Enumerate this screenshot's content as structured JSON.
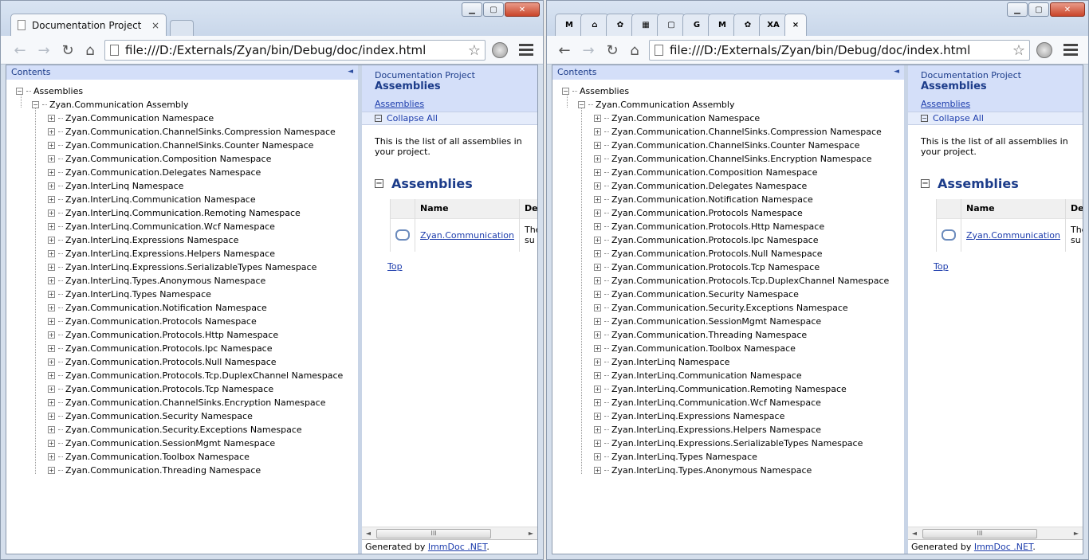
{
  "window1": {
    "tab_title": "Documentation Project",
    "tab_close": "×",
    "url": "file:///D:/Externals/Zyan/bin/Debug/doc/index.html",
    "tree_items": [
      "Zyan.Communication Namespace",
      "Zyan.Communication.ChannelSinks.Compression Namespace",
      "Zyan.Communication.ChannelSinks.Counter Namespace",
      "Zyan.Communication.Composition Namespace",
      "Zyan.Communication.Delegates Namespace",
      "Zyan.InterLinq Namespace",
      "Zyan.InterLinq.Communication Namespace",
      "Zyan.InterLinq.Communication.Remoting Namespace",
      "Zyan.InterLinq.Communication.Wcf Namespace",
      "Zyan.InterLinq.Expressions Namespace",
      "Zyan.InterLinq.Expressions.Helpers Namespace",
      "Zyan.InterLinq.Expressions.SerializableTypes Namespace",
      "Zyan.InterLinq.Types.Anonymous Namespace",
      "Zyan.InterLinq.Types Namespace",
      "Zyan.Communication.Notification Namespace",
      "Zyan.Communication.Protocols Namespace",
      "Zyan.Communication.Protocols.Http Namespace",
      "Zyan.Communication.Protocols.Ipc Namespace",
      "Zyan.Communication.Protocols.Null Namespace",
      "Zyan.Communication.Protocols.Tcp.DuplexChannel Namespace",
      "Zyan.Communication.Protocols.Tcp Namespace",
      "Zyan.Communication.ChannelSinks.Encryption Namespace",
      "Zyan.Communication.Security Namespace",
      "Zyan.Communication.Security.Exceptions Namespace",
      "Zyan.Communication.SessionMgmt Namespace",
      "Zyan.Communication.Toolbox Namespace",
      "Zyan.Communication.Threading Namespace"
    ]
  },
  "window2": {
    "pinned_tabs": [
      "M",
      "⌂",
      "✿",
      "▦",
      "▢",
      "G",
      "M",
      "✿",
      "XA"
    ],
    "active_tab_close": "×",
    "url": "file:///D:/Externals/Zyan/bin/Debug/doc/index.html",
    "tree_items": [
      "Zyan.Communication Namespace",
      "Zyan.Communication.ChannelSinks.Compression Namespace",
      "Zyan.Communication.ChannelSinks.Counter Namespace",
      "Zyan.Communication.ChannelSinks.Encryption Namespace",
      "Zyan.Communication.Composition Namespace",
      "Zyan.Communication.Delegates Namespace",
      "Zyan.Communication.Notification Namespace",
      "Zyan.Communication.Protocols Namespace",
      "Zyan.Communication.Protocols.Http Namespace",
      "Zyan.Communication.Protocols.Ipc Namespace",
      "Zyan.Communication.Protocols.Null Namespace",
      "Zyan.Communication.Protocols.Tcp Namespace",
      "Zyan.Communication.Protocols.Tcp.DuplexChannel Namespace",
      "Zyan.Communication.Security Namespace",
      "Zyan.Communication.Security.Exceptions Namespace",
      "Zyan.Communication.SessionMgmt Namespace",
      "Zyan.Communication.Threading Namespace",
      "Zyan.Communication.Toolbox Namespace",
      "Zyan.InterLinq Namespace",
      "Zyan.InterLinq.Communication Namespace",
      "Zyan.InterLinq.Communication.Remoting Namespace",
      "Zyan.InterLinq.Communication.Wcf Namespace",
      "Zyan.InterLinq.Expressions Namespace",
      "Zyan.InterLinq.Expressions.Helpers Namespace",
      "Zyan.InterLinq.Expressions.SerializableTypes Namespace",
      "Zyan.InterLinq.Types Namespace",
      "Zyan.InterLinq.Types.Anonymous Namespace"
    ]
  },
  "shared": {
    "contents_label": "Contents",
    "collapse_pane_arrow": "◄",
    "tree_root": "Assemblies",
    "tree_assembly": "Zyan.Communication Assembly",
    "project_label": "Documentation Project",
    "page_title": "Assemblies",
    "breadcrumb_link": "Assemblies",
    "collapse_all": "Collapse All",
    "description": "This is the list of all assemblies in your project.",
    "section_title": "Assemblies",
    "table_headers": [
      "Name",
      "De"
    ],
    "table_row_name": "Zyan.Communication",
    "table_row_desc": "The su",
    "top_link": "Top",
    "footer_prefix": "Generated by ",
    "footer_link": "ImmDoc .NET",
    "footer_suffix": ".",
    "scroll_thumb": "III",
    "minimize_glyph": "▁",
    "maximize_glyph": "▢",
    "close_glyph": "✕",
    "plus": "+",
    "minus": "−"
  }
}
